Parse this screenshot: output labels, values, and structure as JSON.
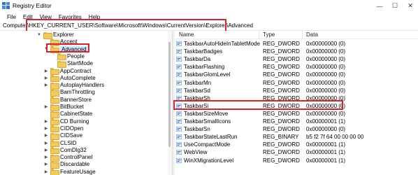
{
  "window": {
    "title": "Registry Editor",
    "minimize": "—",
    "maximize": "☐",
    "close": "✕"
  },
  "menu": [
    "File",
    "Edit",
    "View",
    "Favorites",
    "Help"
  ],
  "address": "Computer\\HKEY_CURRENT_USER\\Software\\Microsoft\\Windows\\CurrentVersion\\Explorer\\Advanced",
  "tree": [
    {
      "label": "Explorer",
      "level": 0,
      "expanded": true
    },
    {
      "label": "Accent",
      "level": 1,
      "expanded": false,
      "noChevron": true
    },
    {
      "label": "Advanced",
      "level": 1,
      "expanded": true,
      "selected": true
    },
    {
      "label": "People",
      "level": 2,
      "noChevron": true
    },
    {
      "label": "StartMode",
      "level": 2,
      "noChevron": true
    },
    {
      "label": "AppContract",
      "level": 1
    },
    {
      "label": "AutoComplete",
      "level": 1
    },
    {
      "label": "AutoplayHandlers",
      "level": 1
    },
    {
      "label": "BamThrottling",
      "level": 1,
      "noChevron": true
    },
    {
      "label": "BannerStore",
      "level": 1,
      "noChevron": true
    },
    {
      "label": "BitBucket",
      "level": 1
    },
    {
      "label": "CabinetState",
      "level": 1,
      "noChevron": true
    },
    {
      "label": "CD Burning",
      "level": 1
    },
    {
      "label": "CIDOpen",
      "level": 1
    },
    {
      "label": "CIDSave",
      "level": 1
    },
    {
      "label": "CLSID",
      "level": 1
    },
    {
      "label": "ComDlg32",
      "level": 1
    },
    {
      "label": "ControlPanel",
      "level": 1
    },
    {
      "label": "Discardable",
      "level": 1
    },
    {
      "label": "FeatureUsage",
      "level": 1
    }
  ],
  "columns": {
    "name": "Name",
    "type": "Type",
    "data": "Data"
  },
  "values": [
    {
      "name": "TaskbarAutoHideInTabletMode",
      "type": "REG_DWORD",
      "data": "0x00000000 (0)"
    },
    {
      "name": "TaskbarBadges",
      "type": "REG_DWORD",
      "data": "0x00000000 (0)"
    },
    {
      "name": "TaskbarDa",
      "type": "REG_DWORD",
      "data": "0x00000000 (0)"
    },
    {
      "name": "TaskbarFlashing",
      "type": "REG_DWORD",
      "data": "0x00000000 (0)"
    },
    {
      "name": "TaskbarGlomLevel",
      "type": "REG_DWORD",
      "data": "0x00000000 (0)"
    },
    {
      "name": "TaskbarMn",
      "type": "REG_DWORD",
      "data": "0x00000000 (0)"
    },
    {
      "name": "TaskbarSd",
      "type": "REG_DWORD",
      "data": "0x00000000 (0)"
    },
    {
      "name": "TaskbarSh",
      "type": "REG_DWORD",
      "data": "0x00000000 (0)"
    },
    {
      "name": "TaskbarSi",
      "type": "REG_DWORD",
      "data": "0x00000000 (0)",
      "highlighted": true
    },
    {
      "name": "TaskbarSizeMove",
      "type": "REG_DWORD",
      "data": "0x00000000 (0)"
    },
    {
      "name": "TaskbarSmallIcons",
      "type": "REG_DWORD",
      "data": "0x00000001 (1)"
    },
    {
      "name": "TaskbarSn",
      "type": "REG_DWORD",
      "data": "0x00000000 (0)"
    },
    {
      "name": "TaskbarStateLastRun",
      "type": "REG_BINARY",
      "data": "b5 f2 7f 64 00 00 00 00"
    },
    {
      "name": "UseCompactMode",
      "type": "REG_DWORD",
      "data": "0x00000001 (1)"
    },
    {
      "name": "WebView",
      "type": "REG_DWORD",
      "data": "0x00000001 (1)"
    },
    {
      "name": "WinXMigrationLevel",
      "type": "REG_DWORD",
      "data": "0x00000001 (1)"
    }
  ],
  "colors": {
    "accent": "#d9232e",
    "folder": "#f5c85a",
    "selection": "#cde8ff",
    "dword_icon": "#2f6fd0"
  }
}
